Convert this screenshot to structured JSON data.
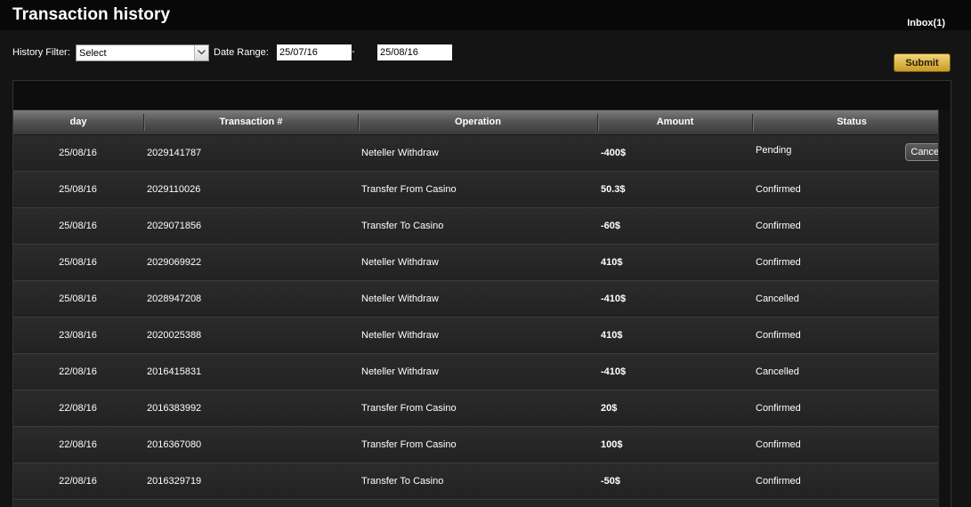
{
  "header": {
    "title": "Transaction history",
    "inbox_label": "Inbox(1)"
  },
  "filters": {
    "history_filter_label": "History Filter:",
    "history_filter_value": "Select",
    "date_range_label": "Date Range:",
    "date_from": "25/07/16",
    "date_separator": "-",
    "date_to": "25/08/16",
    "submit_label": "Submit"
  },
  "table": {
    "columns": [
      "day",
      "Transaction #",
      "Operation",
      "Amount",
      "Status"
    ],
    "cancel_label": "Cancel",
    "rows": [
      {
        "day": "25/08/16",
        "txn": "2029141787",
        "operation": "Neteller Withdraw",
        "amount": "-400$",
        "status": "Pending",
        "cancellable": true
      },
      {
        "day": "25/08/16",
        "txn": "2029110026",
        "operation": "Transfer From Casino",
        "amount": "50.3$",
        "status": "Confirmed",
        "cancellable": false
      },
      {
        "day": "25/08/16",
        "txn": "2029071856",
        "operation": "Transfer To Casino",
        "amount": "-60$",
        "status": "Confirmed",
        "cancellable": false
      },
      {
        "day": "25/08/16",
        "txn": "2029069922",
        "operation": "Neteller Withdraw",
        "amount": "410$",
        "status": "Confirmed",
        "cancellable": false
      },
      {
        "day": "25/08/16",
        "txn": "2028947208",
        "operation": "Neteller Withdraw",
        "amount": "-410$",
        "status": "Cancelled",
        "cancellable": false
      },
      {
        "day": "23/08/16",
        "txn": "2020025388",
        "operation": "Neteller Withdraw",
        "amount": "410$",
        "status": "Confirmed",
        "cancellable": false
      },
      {
        "day": "22/08/16",
        "txn": "2016415831",
        "operation": "Neteller Withdraw",
        "amount": "-410$",
        "status": "Cancelled",
        "cancellable": false
      },
      {
        "day": "22/08/16",
        "txn": "2016383992",
        "operation": "Transfer From Casino",
        "amount": "20$",
        "status": "Confirmed",
        "cancellable": false
      },
      {
        "day": "22/08/16",
        "txn": "2016367080",
        "operation": "Transfer From Casino",
        "amount": "100$",
        "status": "Confirmed",
        "cancellable": false
      },
      {
        "day": "22/08/16",
        "txn": "2016329719",
        "operation": "Transfer To Casino",
        "amount": "-50$",
        "status": "Confirmed",
        "cancellable": false
      }
    ]
  },
  "colors": {
    "page_background": "#141414",
    "submit_gold": "#e0b84a",
    "header_gradient_top": "#7c7c7c"
  },
  "icons": {
    "select_arrow": "chevron-down-icon"
  }
}
